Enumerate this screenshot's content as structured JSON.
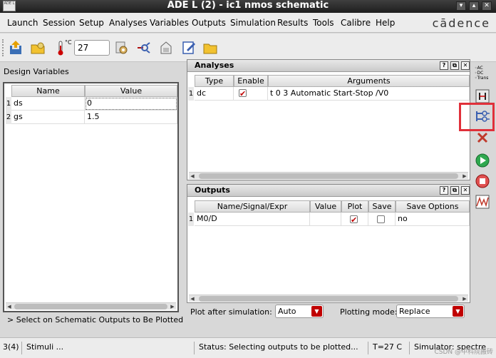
{
  "window": {
    "title": "ADE L (2) - ic1 nmos schematic",
    "app_icon_text": "ADE L",
    "controls": [
      "minimize",
      "maximize",
      "close"
    ]
  },
  "menubar": {
    "items": [
      "Launch",
      "Session",
      "Setup",
      "Analyses",
      "Variables",
      "Outputs",
      "Simulation",
      "Results",
      "Tools",
      "Calibre",
      "Help"
    ],
    "brand": "cādence"
  },
  "toolbar": {
    "temperature_unit": "°C",
    "temperature_value": "27",
    "icons": [
      "save-state-icon",
      "load-state-icon",
      "thermometer-icon",
      "choose-simulator-icon",
      "setup-model-icon",
      "netlist-icon",
      "edit-variables-icon",
      "open-folder-icon"
    ]
  },
  "design_variables": {
    "label": "Design Variables",
    "columns": [
      "Name",
      "Value"
    ],
    "rows": [
      {
        "num": "1",
        "name": "ds",
        "value": "0"
      },
      {
        "num": "2",
        "name": "gs",
        "value": "1.5"
      }
    ]
  },
  "analyses": {
    "title": "Analyses",
    "columns": [
      "Type",
      "Enable",
      "Arguments"
    ],
    "rows": [
      {
        "num": "1",
        "type": "dc",
        "enabled": true,
        "arguments": "t 0 3 Automatic Start-Stop /V0"
      }
    ]
  },
  "outputs": {
    "title": "Outputs",
    "columns": [
      "Name/Signal/Expr",
      "Value",
      "Plot",
      "Save",
      "Save Options"
    ],
    "rows": [
      {
        "num": "1",
        "name": "M0/D",
        "value": "",
        "plot": true,
        "save": false,
        "save_options": "no"
      }
    ]
  },
  "panel_buttons": [
    "?",
    "⧉",
    "✕"
  ],
  "hint": "> Select on Schematic Outputs to Be Plotted",
  "plot_after": {
    "label": "Plot after simulation:",
    "value": "Auto"
  },
  "plotting_mode": {
    "label": "Plotting mode:",
    "value": "Replace"
  },
  "right_toolbar": {
    "analysis_mini_labels": [
      "AC",
      "DC",
      "Trans"
    ],
    "icons": [
      "choose-analysis-icon",
      "variables-icon",
      "outputs-icon",
      "delete-icon",
      "run-icon",
      "stop-icon",
      "plot-outputs-icon"
    ]
  },
  "statusbar": {
    "line": "3(4)",
    "mode": "Stimuli ...",
    "status": "Status: Selecting outputs to be plotted...",
    "temp": "T=27 C",
    "simulator": "Simulator: spectre"
  },
  "watermark": "CSDN @中科院搬砖"
}
